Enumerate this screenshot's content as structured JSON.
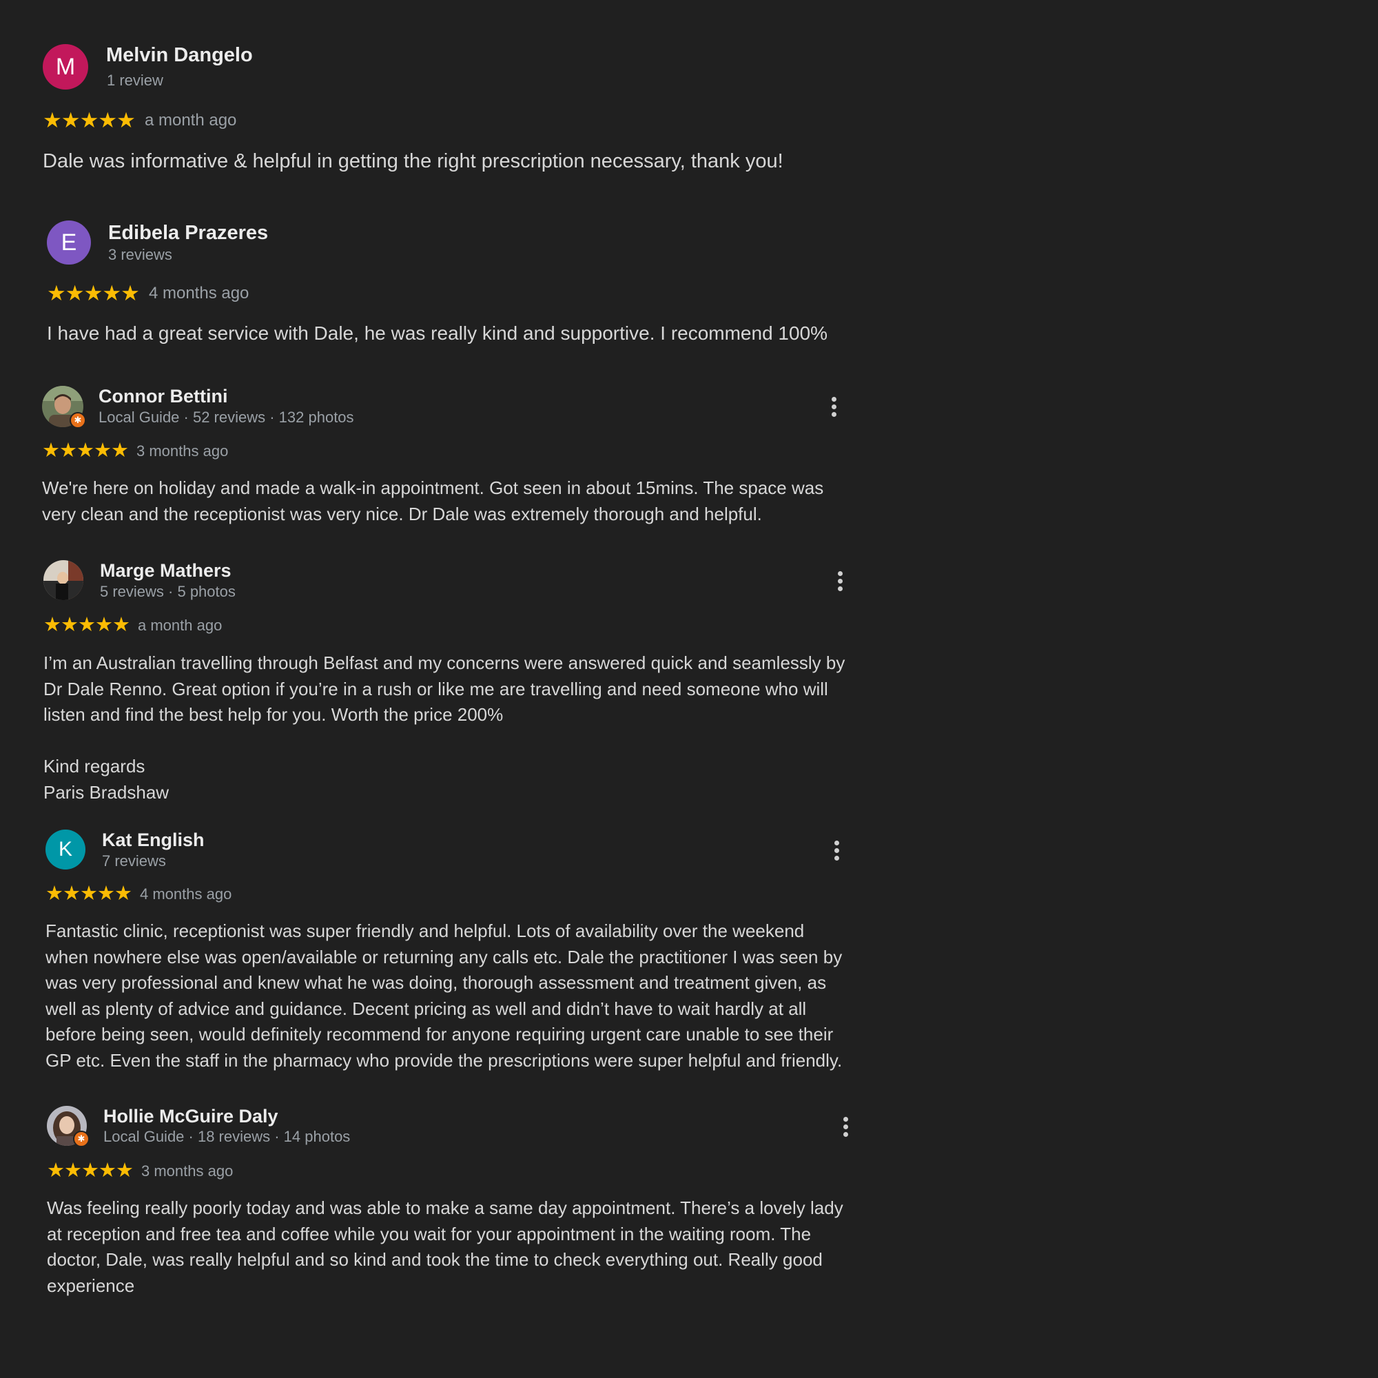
{
  "colors": {
    "background": "#202020",
    "star": "#fbbc04",
    "meta_text": "#9aa0a6",
    "local_guide_badge": "#e8711a"
  },
  "reviews": [
    {
      "avatar_letter": "M",
      "avatar_color": "#c2185b",
      "name": "Melvin Dangelo",
      "meta": "1 review",
      "rating": 5,
      "stars": "★★★★★",
      "date": "a month ago",
      "text": "Dale was informative & helpful in getting the right prescription necessary, thank you!"
    },
    {
      "avatar_letter": "E",
      "avatar_color": "#7e57c2",
      "name": "Edibela Prazeres",
      "meta": "3 reviews",
      "rating": 5,
      "stars": "★★★★★",
      "date": "4 months ago",
      "text": "I have had a great service with Dale, he was really kind and supportive. I recommend 100%"
    },
    {
      "avatar_icon": "profile-photo-icon",
      "name": "Connor Bettini",
      "meta": "Local Guide · 52 reviews · 132 photos",
      "rating": 5,
      "stars": "★★★★★",
      "date": "3 months ago",
      "text": "We're here on holiday and made a walk-in appointment. Got seen in about 15mins. The space was\nvery clean and the receptionist was very nice. Dr Dale was extremely thorough and helpful."
    },
    {
      "avatar_icon": "profile-photo-icon",
      "name": "Marge Mathers",
      "meta": "5 reviews · 5 photos",
      "rating": 5,
      "stars": "★★★★★",
      "date": "a month ago",
      "text": "I’m an Australian travelling through Belfast and my concerns were answered quick and seamlessly by\nDr Dale Renno. Great option if you’re in a rush or like me are travelling and need someone who will\nlisten and find the best help for you. Worth the price 200%\n\nKind regards\nParis Bradshaw"
    },
    {
      "avatar_letter": "K",
      "avatar_color": "#0097a7",
      "name": "Kat English",
      "meta": "7 reviews",
      "rating": 5,
      "stars": "★★★★★",
      "date": "4 months ago",
      "text": "Fantastic clinic, receptionist was super friendly and helpful. Lots of availability over the weekend\nwhen nowhere else was open/available or returning any calls etc. Dale the practitioner I was seen by\nwas very professional and knew what he was doing, thorough assessment and treatment given, as\nwell as plenty of advice and guidance. Decent pricing as well and didn’t have to wait hardly at all\nbefore being seen, would definitely recommend for anyone requiring urgent care unable to see their\nGP etc. Even the staff in the pharmacy who provide the prescriptions were super helpful and friendly."
    },
    {
      "avatar_icon": "profile-photo-icon",
      "name": "Hollie McGuire Daly",
      "meta": "Local Guide · 18 reviews · 14 photos",
      "rating": 5,
      "stars": "★★★★★",
      "date": "3 months ago",
      "text": "Was feeling really poorly today and was able to make a same day appointment. There’s a lovely lady\nat reception and free tea and coffee while you wait for your appointment in the waiting room. The\ndoctor, Dale, was really helpful and so kind and took the time to check everything out. Really good\nexperience"
    }
  ]
}
